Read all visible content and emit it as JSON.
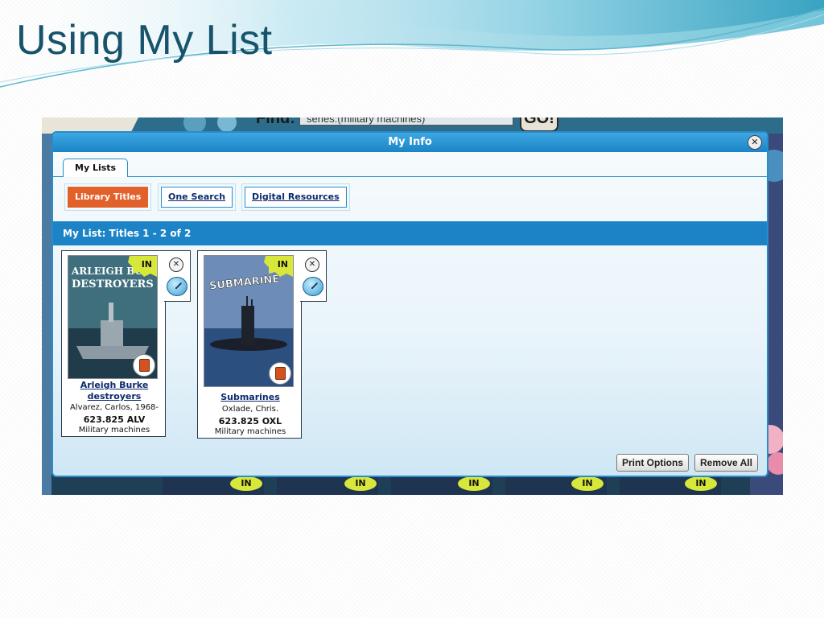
{
  "slide": {
    "title": "Using My List"
  },
  "background_page": {
    "find_label": "Find:",
    "search_value": "series:(military machines)",
    "go_label": "GO!",
    "in_badges": [
      "IN",
      "IN",
      "IN",
      "IN",
      "IN"
    ]
  },
  "modal": {
    "title": "My Info",
    "tab_label": "My Lists",
    "subtabs": [
      {
        "label": "Library Titles",
        "active": true
      },
      {
        "label": "One Search",
        "active": false
      },
      {
        "label": "Digital Resources",
        "active": false
      }
    ],
    "list_header": "My List: Titles 1 - 2 of 2",
    "items": [
      {
        "availability": "IN",
        "cover_text": [
          "ARLEIGH BU",
          "DESTROYERS"
        ],
        "title_lines": [
          "Arleigh Burke",
          "destroyers"
        ],
        "author": "Alvarez, Carlos, 1968-",
        "call_number": "623.825 ALV",
        "series": "Military machines"
      },
      {
        "availability": "IN",
        "cover_text": [
          "SUBMARINE"
        ],
        "title_lines": [
          "Submarines"
        ],
        "author": "Oxlade, Chris.",
        "call_number": "623.825 OXL",
        "series": "Military machines"
      }
    ],
    "buttons": {
      "print": "Print Options",
      "remove_all": "Remove All"
    }
  },
  "colors": {
    "header_blue": "#1c84c6",
    "active_tab_orange": "#e2602a",
    "title_teal": "#17546b",
    "in_badge_green": "#d8e83a"
  }
}
